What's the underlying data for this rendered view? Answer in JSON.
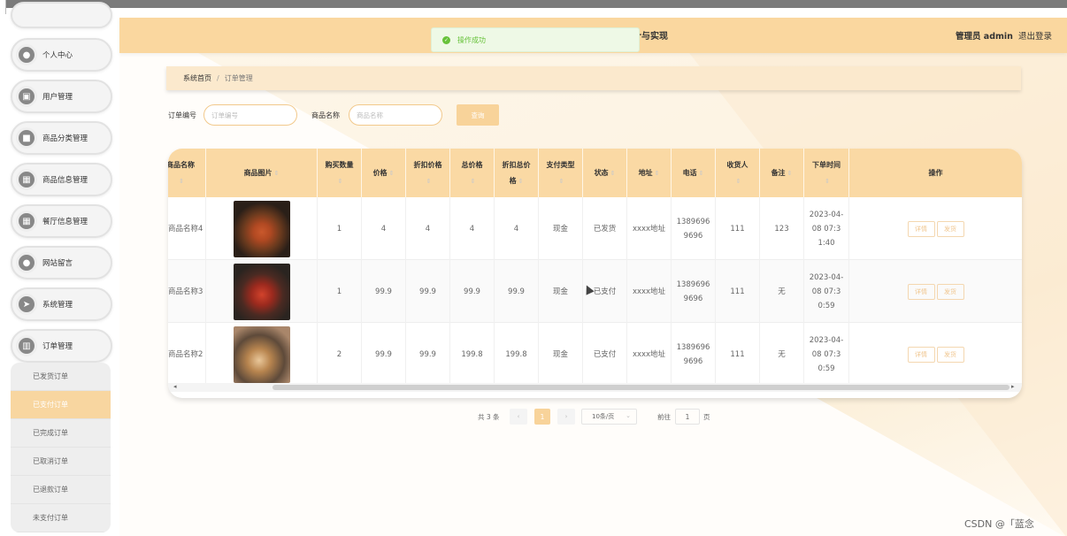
{
  "sidebar": {
    "items": [
      {
        "label": "个人中心",
        "icon": "user-icon",
        "glyph": "●"
      },
      {
        "label": "用户管理",
        "icon": "user-group-icon",
        "glyph": "▣"
      },
      {
        "label": "商品分类管理",
        "icon": "category-icon",
        "glyph": "■"
      },
      {
        "label": "商品信息管理",
        "icon": "grid-icon",
        "glyph": "▦"
      },
      {
        "label": "餐厅信息管理",
        "icon": "grid-icon",
        "glyph": "▦"
      },
      {
        "label": "网站留言",
        "icon": "user-icon",
        "glyph": "●"
      },
      {
        "label": "系统管理",
        "icon": "send-icon",
        "glyph": "➤"
      },
      {
        "label": "订单管理",
        "icon": "chart-icon",
        "glyph": "▥"
      }
    ],
    "submenu": [
      "已发货订单",
      "已支付订单",
      "已完成订单",
      "已取消订单",
      "已退款订单",
      "未支付订单"
    ]
  },
  "header": {
    "title": "计与实现",
    "user": "管理员 admin",
    "logout": "退出登录"
  },
  "toast": {
    "text": "操作成功"
  },
  "breadcrumb": {
    "home": "系统首页",
    "sep": "/",
    "current": "订单管理"
  },
  "search": {
    "order_label": "订单编号",
    "order_placeholder": "订单编号",
    "product_label": "商品名称",
    "product_placeholder": "商品名称",
    "button": "查询"
  },
  "table": {
    "columns": [
      "商品名称",
      "商品图片",
      "购买数量",
      "价格",
      "折扣价格",
      "总价格",
      "折扣总价格",
      "支付类型",
      "状态",
      "地址",
      "电话",
      "收货人",
      "备注",
      "下单时间",
      "操作"
    ],
    "rows": [
      {
        "name": "商品名称4",
        "qty": "1",
        "price": "4",
        "disc_price": "4",
        "total": "4",
        "disc_total": "4",
        "pay": "现金",
        "status": "已发货",
        "addr": "xxxx地址",
        "phone": "13896969696",
        "receiver": "111",
        "note": "123",
        "time": "2023-04-08 07:31:40",
        "img": "paella-dish"
      },
      {
        "name": "商品名称3",
        "qty": "1",
        "price": "99.9",
        "disc_price": "99.9",
        "total": "99.9",
        "disc_total": "99.9",
        "pay": "现金",
        "status": "已支付",
        "addr": "xxxx地址",
        "phone": "13896969696",
        "receiver": "111",
        "note": "无",
        "time": "2023-04-08 07:30:59",
        "img": "chili-dish"
      },
      {
        "name": "商品名称2",
        "qty": "2",
        "price": "99.9",
        "disc_price": "99.9",
        "total": "199.8",
        "disc_total": "199.8",
        "pay": "现金",
        "status": "已支付",
        "addr": "xxxx地址",
        "phone": "13896969696",
        "receiver": "111",
        "note": "无",
        "time": "2023-04-08 07:30:59",
        "img": "noodle-dish"
      }
    ],
    "detail_btn": "详情",
    "ship_btn": "发货"
  },
  "pagination": {
    "total": "共 3 条",
    "page": "1",
    "size": "10条/页",
    "goto": "前往",
    "goto_value": "1",
    "page_suffix": "页"
  },
  "watermark": "CSDN @「蓝念",
  "colors": {
    "accent": "#fad79f",
    "success": "#67c23a"
  }
}
